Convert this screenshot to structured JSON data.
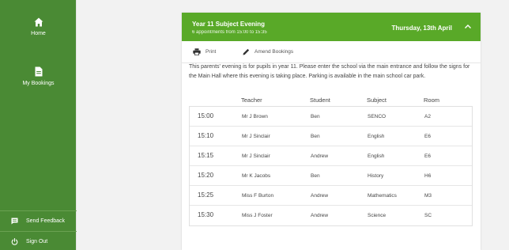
{
  "sidebar": {
    "items": [
      {
        "label": "Home",
        "icon": "home-icon"
      },
      {
        "label": "My Bookings",
        "icon": "document-icon"
      }
    ],
    "footer": [
      {
        "label": "Send Feedback",
        "icon": "feedback-icon"
      },
      {
        "label": "Sign Out",
        "icon": "power-icon"
      }
    ]
  },
  "event": {
    "title": "Year 11 Subject Evening",
    "subtitle": "6 appointments from 15:00 to 15:35",
    "date": "Thursday, 13th April",
    "chevron_icon": "chevron-up-icon"
  },
  "toolbar": {
    "print_label": "Print",
    "amend_label": "Amend Bookings"
  },
  "description": "This parents' evening is for pupils in year 11. Please enter the school via the main entrance and follow the signs for the Main Hall where this evening is taking place. Parking is available in the main school car park.",
  "table": {
    "headers": {
      "teacher": "Teacher",
      "student": "Student",
      "subject": "Subject",
      "room": "Room"
    },
    "rows": [
      {
        "time": "15:00",
        "teacher": "Mr J Brown",
        "student": "Ben",
        "subject": "SENCO",
        "room": "A2"
      },
      {
        "time": "15:10",
        "teacher": "Mr J Sinclair",
        "student": "Ben",
        "subject": "English",
        "room": "E6"
      },
      {
        "time": "15:15",
        "teacher": "Mr J Sinclair",
        "student": "Andrew",
        "subject": "English",
        "room": "E6"
      },
      {
        "time": "15:20",
        "teacher": "Mr K Jacobs",
        "student": "Ben",
        "subject": "History",
        "room": "H6"
      },
      {
        "time": "15:25",
        "teacher": "Miss F Burton",
        "student": "Andrew",
        "subject": "Mathematics",
        "room": "M3"
      },
      {
        "time": "15:30",
        "teacher": "Miss J Foster",
        "student": "Andrew",
        "subject": "Science",
        "room": "SC"
      }
    ]
  },
  "colors": {
    "sidebar": "#4a8a34",
    "header": "#59a928"
  }
}
